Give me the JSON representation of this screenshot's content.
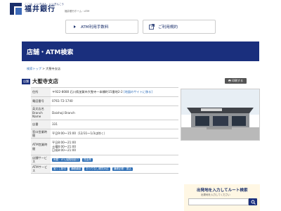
{
  "header": {
    "tagline": "ここは、いいちばん、いいぎんこう",
    "bank_name": "福井銀行",
    "top_link": "福井銀行ホーム › ATM"
  },
  "quick_nav": {
    "atm_fee": "ATM利用手数料",
    "guide": "ご利用規約"
  },
  "banner": {
    "title": "店舗・ATM検索"
  },
  "breadcrumb": {
    "home": "検索トップ",
    "separator": " > ",
    "current": "大聖寺支店"
  },
  "branch": {
    "badge": "店舗",
    "name": "大聖寺支店",
    "print_label": "🖶 印刷する",
    "rows": {
      "address": {
        "label": "住所",
        "value": "〒922-8080 石川県加賀市大聖寺一本橋町15番地2-2",
        "map_link": "[地図のサイトに移る]"
      },
      "phone": {
        "label": "電話番号",
        "value": "0761-72-1740"
      },
      "english_name": {
        "label": "英文店名 Branch Name",
        "value": "Daishoji Branch"
      },
      "branch_no": {
        "label": "店番",
        "value": "331"
      },
      "teller_hours": {
        "label": "窓口営業時間",
        "value": "平日9:00～15:00（12/31～1/3は除く）"
      },
      "atm_hours": {
        "label": "ATM営業時間",
        "lines": [
          "平日8:00～21:00",
          "土曜8:00～21:00",
          "日祝8:00～21:00"
        ]
      },
      "services": {
        "label": "店舗サービス",
        "tags": [
          "両替・がん保険相談口",
          "貸金庫"
        ]
      },
      "atm_services": {
        "label": "ATMサービス",
        "tags": [
          "宝くじ配付",
          "通帳繰越",
          "おつりなし硬貨対応",
          "通帳記帳・振込"
        ]
      }
    }
  },
  "route": {
    "title": "出発地を入力してルート検索",
    "subtitle": "出発地を入力してください"
  }
}
